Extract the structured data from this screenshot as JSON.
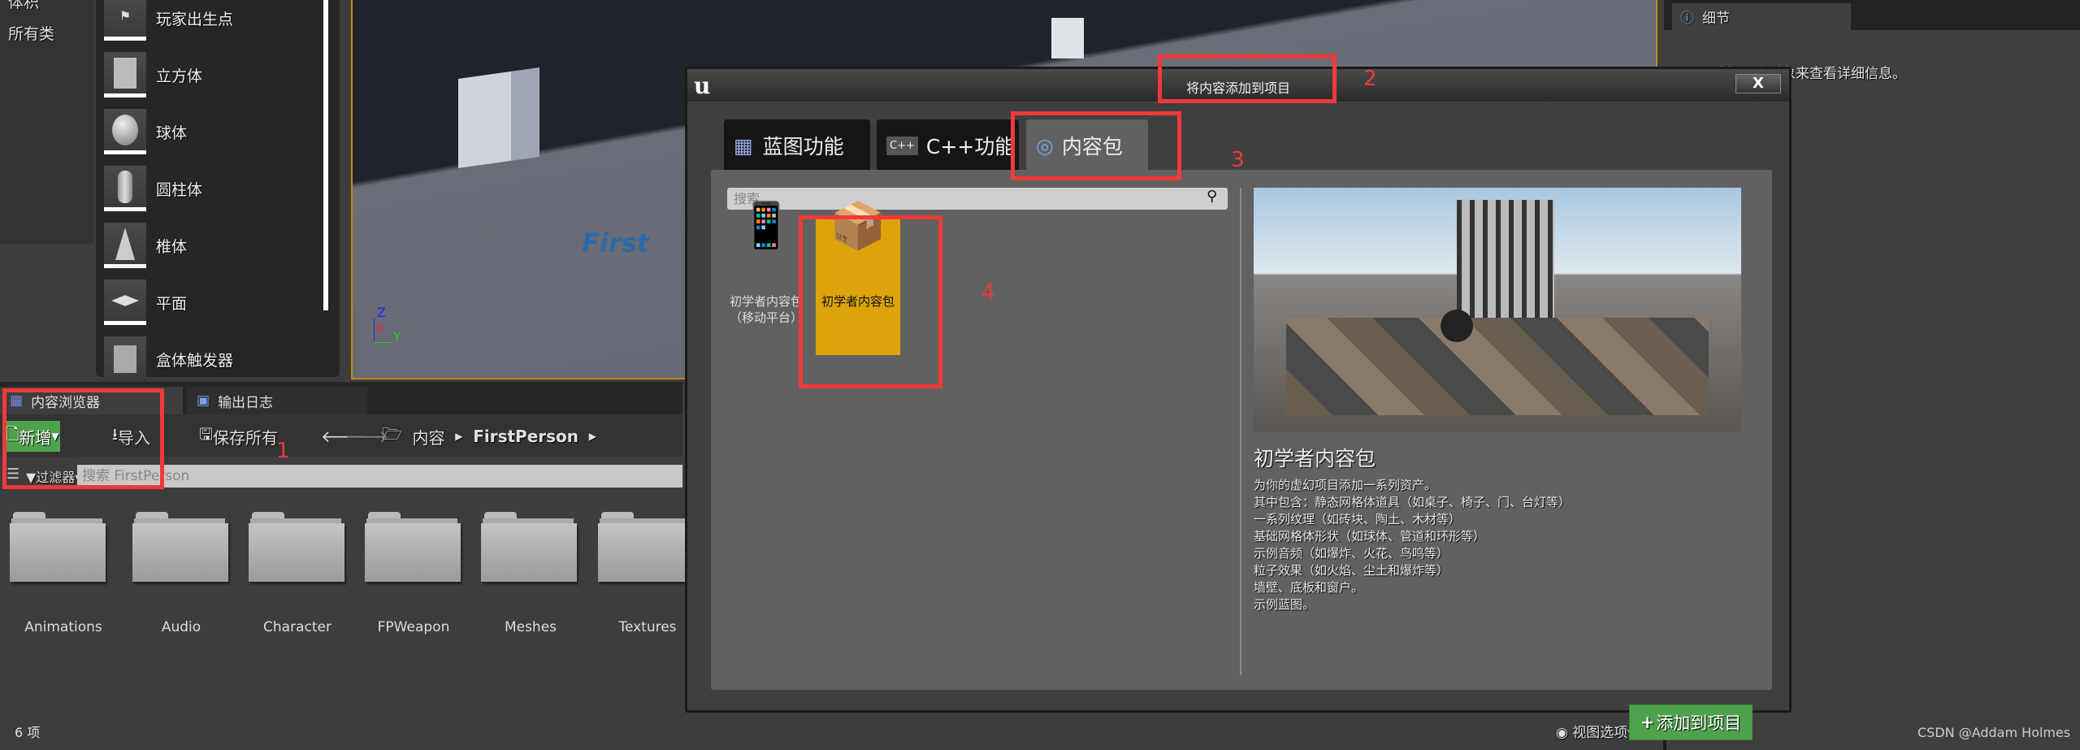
{
  "categories": {
    "partial_top": "体积",
    "all_classes": "所有类"
  },
  "place_actors": [
    "玩家出生点",
    "立方体",
    "球体",
    "圆柱体",
    "椎体",
    "平面",
    "盒体触发器"
  ],
  "viewport": {
    "axis_z": "Z",
    "axis_x": "X",
    "axis_y": "Y",
    "floor_text": "First"
  },
  "details": {
    "tab_label": "细节",
    "empty_message": "选择一个对象来查看详细信息。"
  },
  "content_browser": {
    "tabs": [
      "内容浏览器",
      "输出日志"
    ],
    "new_label": "新增",
    "import_label": "导入",
    "save_all_label": "保存所有",
    "breadcrumb": [
      "内容",
      "FirstPerson"
    ],
    "filter_label": "过滤器",
    "search_placeholder": "搜索 FirstPerson",
    "folders": [
      "Animations",
      "Audio",
      "Character",
      "FPWeapon",
      "Meshes",
      "Textures"
    ],
    "item_count": "6 项",
    "view_options": "视图选项"
  },
  "dialog": {
    "title": "将内容添加到项目",
    "close": "X",
    "tabs": [
      "蓝图功能",
      "C++功能",
      "内容包"
    ],
    "active_tab": 2,
    "search_placeholder": "搜索",
    "packs": [
      {
        "label": "初学者内容包（移动平台）"
      },
      {
        "label": "初学者内容包",
        "selected": true
      }
    ],
    "preview_title": "初学者内容包",
    "description": [
      "为你的虚幻项目添加一系列资产。",
      "其中包含：静态网格体道具（如桌子、椅子、门、台灯等）",
      "一系列纹理（如砖块、陶土、木材等）",
      "基础网格体形状（如球体、管道和环形等）",
      "示例音频（如爆炸、火花、鸟鸣等）",
      "粒子效果（如火焰、尘土和爆炸等）",
      "墙壁、底板和窗户。",
      "示例蓝图。"
    ],
    "add_button": "添加到项目"
  },
  "annotations": [
    "1",
    "2",
    "3",
    "4"
  ],
  "watermark": "CSDN @Addam Holmes",
  "colors": {
    "accent_green": "#4ea24c",
    "selected_yellow": "#dca30b",
    "annotation_red": "#f03a3a"
  }
}
